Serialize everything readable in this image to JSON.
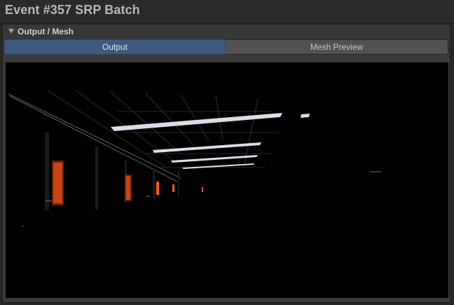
{
  "window": {
    "title": "Event #357 SRP Batch"
  },
  "foldout": {
    "label": "Output / Mesh",
    "icon": "triangle-down-icon",
    "expanded": true
  },
  "tabs": [
    {
      "label": "Output",
      "active": true
    },
    {
      "label": "Mesh Preview",
      "active": false
    }
  ],
  "colors": {
    "active_tab": "#3e5b7f",
    "inactive_tab": "#515151",
    "panel": "#3a3a3a",
    "viewport": "#000000",
    "light_orange": "#ff5a14"
  },
  "viewport": {
    "content": "rendered-output-image"
  }
}
